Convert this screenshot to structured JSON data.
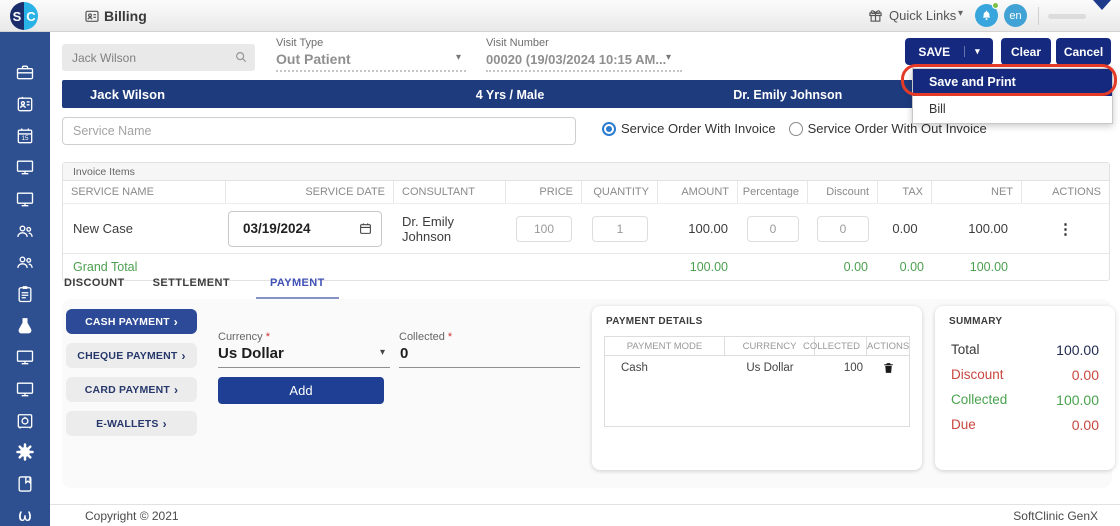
{
  "topbar": {
    "page_title": "Billing",
    "quick_links_label": "Quick Links",
    "language": "en",
    "logo": {
      "left": "S",
      "right": "C"
    }
  },
  "toolbar": {
    "search_value": "Jack Wilson",
    "visit_type": {
      "label": "Visit Type",
      "value": "Out Patient"
    },
    "visit_number": {
      "label": "Visit Number",
      "value": "00020 (19/03/2024 10:15 AM..."
    },
    "save_label": "SAVE",
    "clear_label": "Clear",
    "cancel_label": "Cancel",
    "save_menu": {
      "items": [
        {
          "label": "Save and Print"
        },
        {
          "label": "Bill"
        }
      ]
    }
  },
  "patient_bar": {
    "name": "Jack Wilson",
    "age_sex": "4 Yrs / Male",
    "doctor": "Dr. Emily Johnson"
  },
  "service_entry": {
    "placeholder": "Service Name",
    "radio_with_invoice": "Service Order With Invoice",
    "radio_without_invoice": "Service Order With Out Invoice"
  },
  "invoice": {
    "panel_title": "Invoice Items",
    "columns": [
      "SERVICE NAME",
      "SERVICE DATE",
      "CONSULTANT",
      "PRICE",
      "QUANTITY",
      "AMOUNT",
      "Percentage",
      "Discount",
      "TAX",
      "NET",
      "ACTIONS"
    ],
    "row": {
      "service_name": "New Case",
      "service_date": "03/19/2024",
      "consultant": "Dr. Emily Johnson",
      "price": "100",
      "quantity": "1",
      "amount": "100.00",
      "percentage": "0",
      "discount": "0",
      "tax": "0.00",
      "net": "100.00"
    },
    "grand_total": {
      "label": "Grand Total",
      "amount": "100.00",
      "discount": "0.00",
      "tax": "0.00",
      "net": "100.00"
    }
  },
  "tabs": {
    "items": [
      {
        "label": "DISCOUNT"
      },
      {
        "label": "SETTLEMENT"
      },
      {
        "label": "PAYMENT"
      }
    ],
    "active": "PAYMENT"
  },
  "payment": {
    "methods": [
      {
        "label": "CASH PAYMENT"
      },
      {
        "label": "CHEQUE PAYMENT"
      },
      {
        "label": "CARD PAYMENT"
      },
      {
        "label": "E-WALLETS"
      }
    ],
    "currency": {
      "label": "Currency",
      "required": "*",
      "value": "Us Dollar"
    },
    "collected": {
      "label": "Collected",
      "required": "*",
      "value": "0"
    },
    "add_label": "Add",
    "details": {
      "title": "PAYMENT DETAILS",
      "columns": [
        "PAYMENT MODE",
        "CURRENCY",
        "COLLECTED",
        "ACTIONS"
      ],
      "rows": [
        {
          "mode": "Cash",
          "currency": "Us Dollar",
          "collected": "100"
        }
      ]
    },
    "summary": {
      "title": "SUMMARY",
      "rows": [
        {
          "label": "Total",
          "value": "100.00"
        },
        {
          "label": "Discount",
          "value": "0.00"
        },
        {
          "label": "Collected",
          "value": "100.00"
        },
        {
          "label": "Due",
          "value": "0.00"
        }
      ]
    }
  },
  "footer": {
    "copyright": "Copyright © 2021",
    "brand": "SoftClinic GenX"
  },
  "sidebar": {
    "icons": [
      "briefcase",
      "id-badge",
      "calendar",
      "monitor",
      "monitor",
      "users",
      "users",
      "clipboard",
      "flask",
      "monitor",
      "monitor",
      "safe",
      "gear",
      "book",
      "stethoscope"
    ]
  },
  "icons": {
    "caret_down": "▾",
    "chevron_right": "›",
    "kebab": "⋮",
    "omega": "ω"
  },
  "colors": {
    "accent_navy": "#152a7e",
    "sidebar_blue": "#2e5090",
    "patient_bar": "#1e3b7e",
    "link_blue": "#3f51b5",
    "success_green": "#4ca050",
    "danger_red": "#c8473f",
    "annotation_red": "#e43a28",
    "bell_blue": "#38a5dc"
  }
}
